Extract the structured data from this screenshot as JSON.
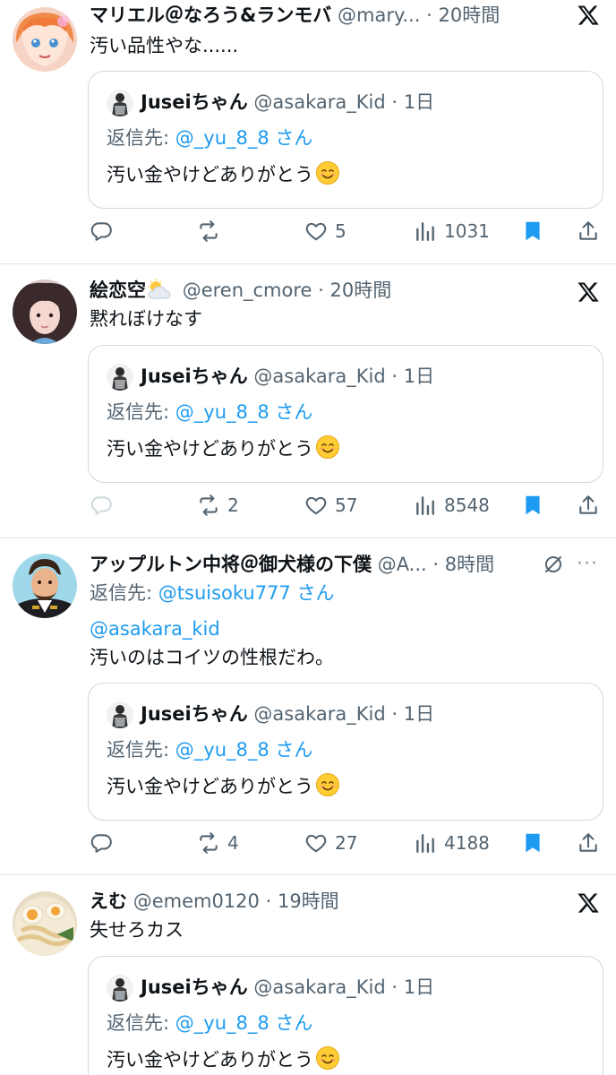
{
  "tweets": [
    {
      "name": "マリエル＠なろう&ランモバ",
      "handle": "@mary...",
      "time": "20時間",
      "text": "汚い品性やな......",
      "reply_prefix": "",
      "reply_user": "",
      "reply_suffix": "",
      "mention": "",
      "quote": {
        "name": "Juseiちゃん",
        "handle": "@asakara_Kid",
        "time": "1日",
        "reply_prefix": "返信先: ",
        "reply_user": "@_yu_8_8",
        "reply_suffix": " さん",
        "text": "汚い金やけどありがとう"
      },
      "reply_count": "",
      "retweets": "",
      "likes": "5",
      "views": "1031"
    },
    {
      "name": "絵恋空",
      "handle": "@eren_cmore",
      "time": "20時間",
      "text": "黙れぼけなす",
      "reply_prefix": "",
      "reply_user": "",
      "reply_suffix": "",
      "mention": "",
      "quote": {
        "name": "Juseiちゃん",
        "handle": "@asakara_Kid",
        "time": "1日",
        "reply_prefix": "返信先: ",
        "reply_user": "@_yu_8_8",
        "reply_suffix": " さん",
        "text": "汚い金やけどありがとう"
      },
      "reply_count": "",
      "retweets": "2",
      "likes": "57",
      "views": "8548"
    },
    {
      "name": "アップルトン中将＠御犬様の下僕",
      "handle": "@A...",
      "time": "8時間",
      "text": "汚いのはコイツの性根だわ。",
      "reply_prefix": "返信先: ",
      "reply_user": "@tsuisoku777",
      "reply_suffix": " さん",
      "mention": "@asakara_kid",
      "quote": {
        "name": "Juseiちゃん",
        "handle": "@asakara_Kid",
        "time": "1日",
        "reply_prefix": "返信先: ",
        "reply_user": "@_yu_8_8",
        "reply_suffix": " さん",
        "text": "汚い金やけどありがとう"
      },
      "reply_count": "",
      "retweets": "4",
      "likes": "27",
      "views": "4188"
    },
    {
      "name": "えむ",
      "handle": "@emem0120",
      "time": "19時間",
      "text": "失せろカス",
      "reply_prefix": "",
      "reply_user": "",
      "reply_suffix": "",
      "mention": "",
      "quote": {
        "name": "Juseiちゃん",
        "handle": "@asakara_Kid",
        "time": "1日",
        "reply_prefix": "返信先: ",
        "reply_user": "@_yu_8_8",
        "reply_suffix": " さん",
        "text": "汚い金やけどありがとう"
      }
    }
  ],
  "time_separator": "·",
  "more_label": "···",
  "icons": {
    "brand": "x-logo-icon",
    "reply": "reply-icon",
    "retweet": "retweet-icon",
    "like": "heart-icon",
    "views": "views-icon",
    "bookmark": "bookmark-icon",
    "share": "share-icon",
    "mute": "mute-icon",
    "more": "more-icon",
    "emoji": "smiling-face-emoji"
  },
  "colors": {
    "link": "#1d9bf0",
    "bookmark_active": "#1d9bf0",
    "secondary_text": "#536471",
    "primary_text": "#0f1419"
  }
}
